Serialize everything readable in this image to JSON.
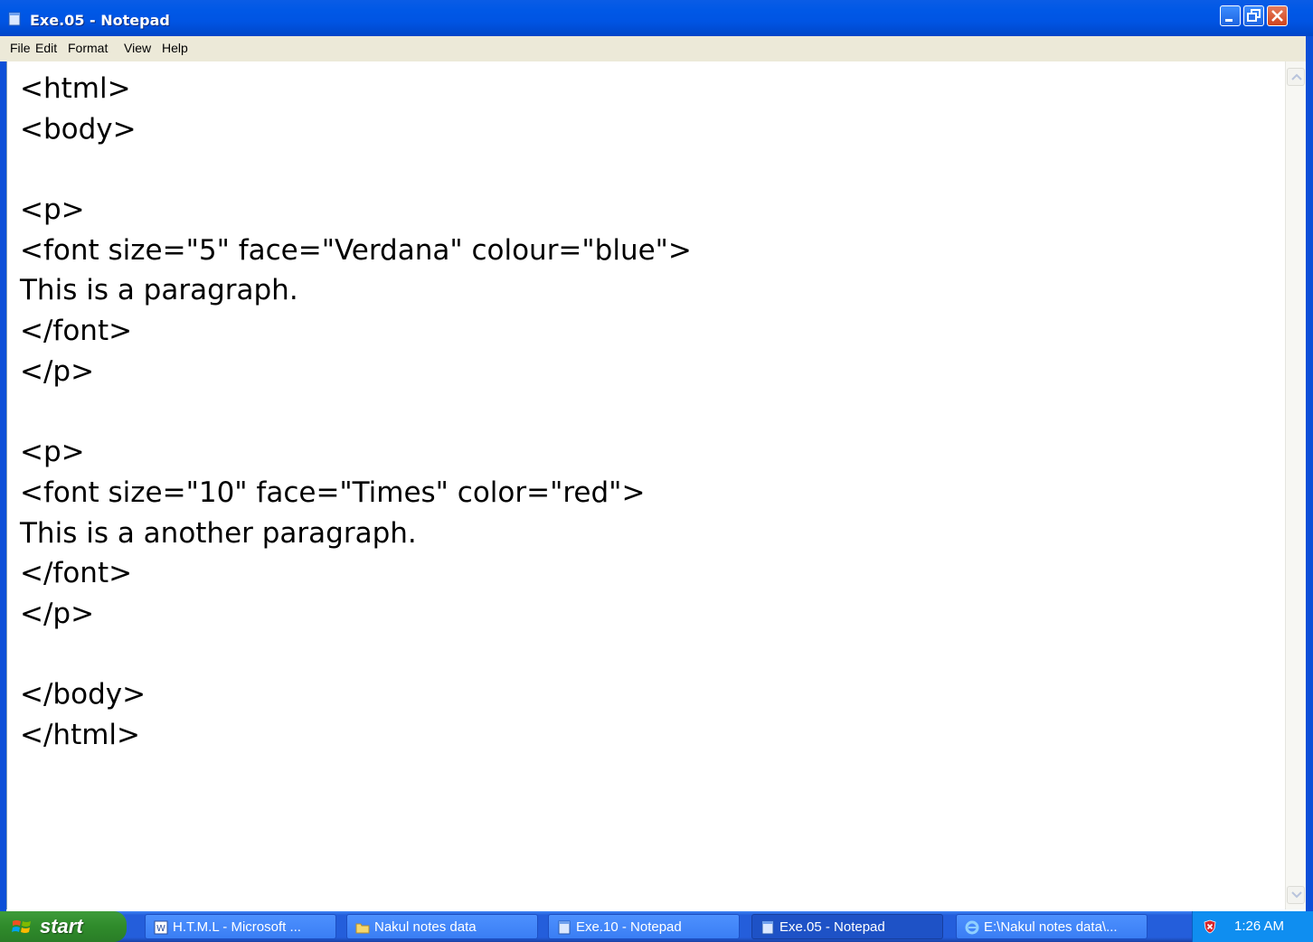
{
  "window": {
    "title": "Exe.05 - Notepad",
    "title_bar_color": "#0054e3"
  },
  "menu": {
    "items": [
      "File",
      "Edit",
      "Format",
      "View",
      "Help"
    ]
  },
  "editor": {
    "lines": [
      "<html>",
      "<body>",
      "",
      "<p>",
      "<font size=\"5\" face=\"Verdana\" colour=\"blue\">",
      "This is a paragraph.",
      "</font>",
      "</p>",
      "",
      "<p>",
      "<font size=\"10\" face=\"Times\" color=\"red\">",
      "This is a another paragraph.",
      "</font>",
      "</p>",
      "",
      "</body>",
      "</html>"
    ]
  },
  "taskbar": {
    "start_label": "start",
    "tasks": [
      {
        "label": "H.T.M.L - Microsoft ...",
        "icon": "word-icon",
        "active": false
      },
      {
        "label": "Nakul notes data",
        "icon": "folder-icon",
        "active": false
      },
      {
        "label": "Exe.10 - Notepad",
        "icon": "notepad-icon",
        "active": false
      },
      {
        "label": "Exe.05 - Notepad",
        "icon": "notepad-icon",
        "active": true
      },
      {
        "label": "E:\\Nakul notes data\\...",
        "icon": "internet-explorer-icon",
        "active": false
      }
    ],
    "clock": "1:26 AM",
    "tray_icon": "security-shield-icon"
  }
}
